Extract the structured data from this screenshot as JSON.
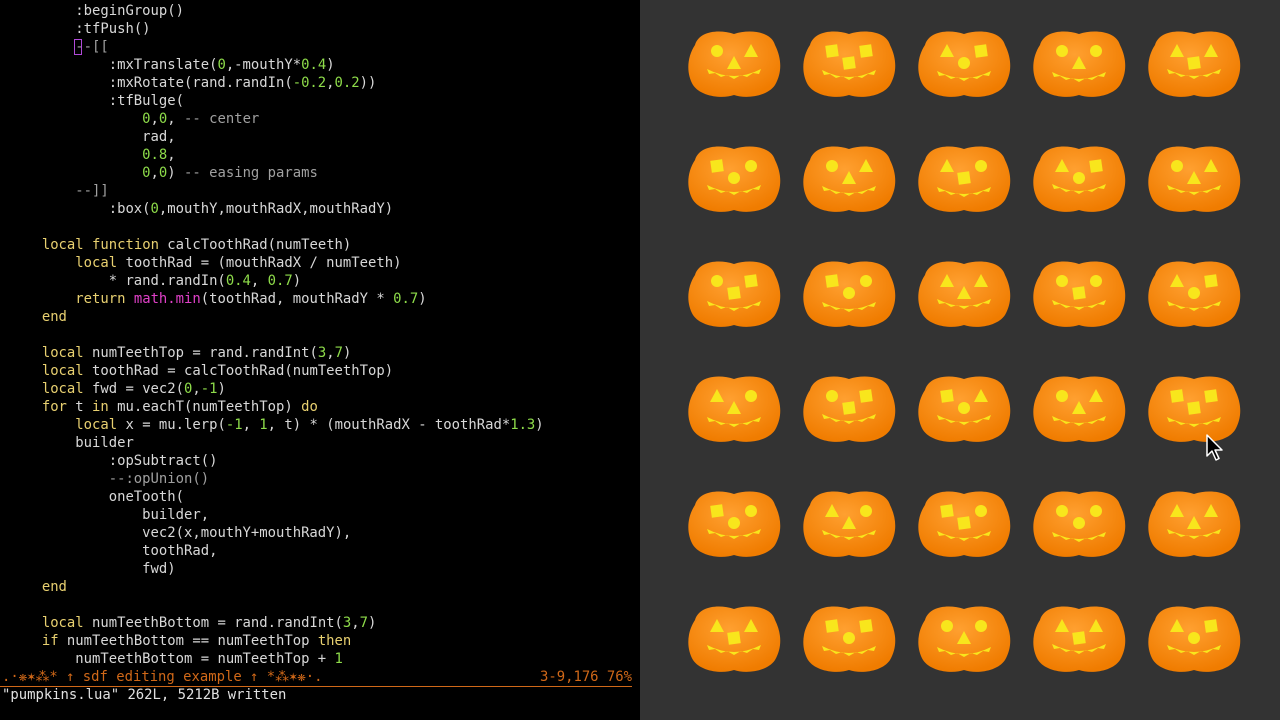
{
  "editor": {
    "lines": [
      {
        "row": 0,
        "indent": 2,
        "tokens": [
          [
            ":beginGroup()",
            "txt"
          ]
        ]
      },
      {
        "row": 1,
        "indent": 2,
        "tokens": [
          [
            ":tfPush()",
            "txt"
          ]
        ]
      },
      {
        "row": 2,
        "indent": 2,
        "tokens": [
          [
            "--[[",
            "com"
          ]
        ]
      },
      {
        "row": 3,
        "indent": 3,
        "tokens": [
          [
            ":mxTranslate(",
            "txt"
          ],
          [
            "0",
            "num"
          ],
          [
            ",-mouthY*",
            "txt"
          ],
          [
            "0.4",
            "num"
          ],
          [
            ")",
            "txt"
          ]
        ]
      },
      {
        "row": 4,
        "indent": 3,
        "tokens": [
          [
            ":mxRotate(rand.randIn(",
            "txt"
          ],
          [
            "-0.2",
            "num"
          ],
          [
            ",",
            "txt"
          ],
          [
            "0.2",
            "num"
          ],
          [
            "))",
            "txt"
          ]
        ]
      },
      {
        "row": 5,
        "indent": 3,
        "tokens": [
          [
            ":tfBulge(",
            "txt"
          ]
        ]
      },
      {
        "row": 6,
        "indent": 4,
        "tokens": [
          [
            "0",
            "num"
          ],
          [
            ",",
            "txt"
          ],
          [
            "0",
            "num"
          ],
          [
            ", ",
            "txt"
          ],
          [
            "-- center",
            "com"
          ]
        ]
      },
      {
        "row": 7,
        "indent": 4,
        "tokens": [
          [
            "rad,",
            "txt"
          ]
        ]
      },
      {
        "row": 8,
        "indent": 4,
        "tokens": [
          [
            "0.8",
            "num"
          ],
          [
            ",",
            "txt"
          ]
        ]
      },
      {
        "row": 9,
        "indent": 4,
        "tokens": [
          [
            "0",
            "num"
          ],
          [
            ",",
            "txt"
          ],
          [
            "0",
            "num"
          ],
          [
            ") ",
            "txt"
          ],
          [
            "-- easing params",
            "com"
          ]
        ]
      },
      {
        "row": 10,
        "indent": 2,
        "tokens": [
          [
            "--]]",
            "com"
          ]
        ]
      },
      {
        "row": 11,
        "indent": 3,
        "tokens": [
          [
            ":box(",
            "txt"
          ],
          [
            "0",
            "num"
          ],
          [
            ",mouthY,mouthRadX,mouthRadY)",
            "txt"
          ]
        ]
      },
      {
        "row": 13,
        "indent": 1,
        "tokens": [
          [
            "local",
            "kw"
          ],
          [
            " ",
            "txt"
          ],
          [
            "function",
            "kw"
          ],
          [
            " calcToothRad(numTeeth)",
            "txt"
          ]
        ]
      },
      {
        "row": 14,
        "indent": 2,
        "tokens": [
          [
            "local",
            "kw"
          ],
          [
            " toothRad = (mouthRadX / numTeeth)",
            "txt"
          ]
        ]
      },
      {
        "row": 15,
        "indent": 3,
        "tokens": [
          [
            "* rand.randIn(",
            "txt"
          ],
          [
            "0.4",
            "num"
          ],
          [
            ", ",
            "txt"
          ],
          [
            "0.7",
            "num"
          ],
          [
            ")",
            "txt"
          ]
        ]
      },
      {
        "row": 16,
        "indent": 2,
        "tokens": [
          [
            "return",
            "kw"
          ],
          [
            " ",
            "txt"
          ],
          [
            "math.min",
            "fn"
          ],
          [
            "(toothRad, mouthRadY * ",
            "txt"
          ],
          [
            "0.7",
            "num"
          ],
          [
            ")",
            "txt"
          ]
        ]
      },
      {
        "row": 17,
        "indent": 1,
        "tokens": [
          [
            "end",
            "kw"
          ]
        ]
      },
      {
        "row": 19,
        "indent": 1,
        "tokens": [
          [
            "local",
            "kw"
          ],
          [
            " numTeethTop = rand.randInt(",
            "txt"
          ],
          [
            "3",
            "num"
          ],
          [
            ",",
            "txt"
          ],
          [
            "7",
            "num"
          ],
          [
            ")",
            "txt"
          ]
        ]
      },
      {
        "row": 20,
        "indent": 1,
        "tokens": [
          [
            "local",
            "kw"
          ],
          [
            " toothRad = calcToothRad(numTeethTop)",
            "txt"
          ]
        ]
      },
      {
        "row": 21,
        "indent": 1,
        "tokens": [
          [
            "local",
            "kw"
          ],
          [
            " fwd = vec2(",
            "txt"
          ],
          [
            "0",
            "num"
          ],
          [
            ",",
            "txt"
          ],
          [
            "-1",
            "num"
          ],
          [
            ")",
            "txt"
          ]
        ]
      },
      {
        "row": 22,
        "indent": 1,
        "tokens": [
          [
            "for",
            "kw"
          ],
          [
            " t ",
            "txt"
          ],
          [
            "in",
            "kw"
          ],
          [
            " mu.eachT(numTeethTop) ",
            "txt"
          ],
          [
            "do",
            "kw"
          ]
        ]
      },
      {
        "row": 23,
        "indent": 2,
        "tokens": [
          [
            "local",
            "kw"
          ],
          [
            " x = mu.lerp(",
            "txt"
          ],
          [
            "-1",
            "num"
          ],
          [
            ", ",
            "txt"
          ],
          [
            "1",
            "num"
          ],
          [
            ", t) * (mouthRadX - toothRad*",
            "txt"
          ],
          [
            "1.3",
            "num"
          ],
          [
            ")",
            "txt"
          ]
        ]
      },
      {
        "row": 24,
        "indent": 2,
        "tokens": [
          [
            "builder",
            "txt"
          ]
        ]
      },
      {
        "row": 25,
        "indent": 3,
        "tokens": [
          [
            ":opSubtract()",
            "txt"
          ]
        ]
      },
      {
        "row": 26,
        "indent": 3,
        "tokens": [
          [
            "--:opUnion()",
            "com"
          ]
        ]
      },
      {
        "row": 27,
        "indent": 3,
        "tokens": [
          [
            "oneTooth(",
            "txt"
          ]
        ]
      },
      {
        "row": 28,
        "indent": 4,
        "tokens": [
          [
            "builder,",
            "txt"
          ]
        ]
      },
      {
        "row": 29,
        "indent": 4,
        "tokens": [
          [
            "vec2(x,mouthY+mouthRadY),",
            "txt"
          ]
        ]
      },
      {
        "row": 30,
        "indent": 4,
        "tokens": [
          [
            "toothRad,",
            "txt"
          ]
        ]
      },
      {
        "row": 31,
        "indent": 4,
        "tokens": [
          [
            "fwd)",
            "txt"
          ]
        ]
      },
      {
        "row": 32,
        "indent": 1,
        "tokens": [
          [
            "end",
            "kw"
          ]
        ]
      },
      {
        "row": 34,
        "indent": 1,
        "tokens": [
          [
            "local",
            "kw"
          ],
          [
            " numTeethBottom = rand.randInt(",
            "txt"
          ],
          [
            "3",
            "num"
          ],
          [
            ",",
            "txt"
          ],
          [
            "7",
            "num"
          ],
          [
            ")",
            "txt"
          ]
        ]
      },
      {
        "row": 35,
        "indent": 1,
        "tokens": [
          [
            "if",
            "kw"
          ],
          [
            " numTeethBottom == numTeethTop ",
            "txt"
          ],
          [
            "then",
            "kw"
          ]
        ]
      },
      {
        "row": 36,
        "indent": 2,
        "tokens": [
          [
            "numTeethBottom = numTeethTop + ",
            "txt"
          ],
          [
            "1",
            "num"
          ]
        ]
      }
    ],
    "statusline": {
      "left": ".·❋✶⁂* ↑ sdf editing example ↑ *⁂✶❋·.",
      "right": "3-9,176 76%"
    },
    "message": "\"pumpkins.lua\" 262L, 5212B written"
  },
  "colors": {
    "keyword": "#e8d070",
    "number": "#8edc4a",
    "comment": "#a0a0a0",
    "builtin": "#e040c8",
    "text": "#d8d8d8",
    "status": "#d06818",
    "viewport_bg": "#333333",
    "pumpkin": "#f07c00",
    "pumpkin_light": "#ffa030",
    "face": "#f8e61c"
  },
  "pumpkins": {
    "rows": 6,
    "cols": 5,
    "faces": [
      [
        "circle",
        "triangle"
      ],
      [
        "square",
        "square"
      ],
      [
        "triangle",
        "square"
      ],
      [
        "circle",
        "circle"
      ],
      [
        "triangle",
        "triangle"
      ],
      [
        "square",
        "circle"
      ],
      [
        "circle",
        "triangle"
      ],
      [
        "triangle",
        "circle"
      ],
      [
        "triangle",
        "square"
      ],
      [
        "circle",
        "triangle"
      ],
      [
        "circle",
        "square"
      ],
      [
        "square",
        "circle"
      ],
      [
        "triangle",
        "triangle"
      ],
      [
        "circle",
        "circle"
      ],
      [
        "triangle",
        "square"
      ],
      [
        "triangle",
        "circle"
      ],
      [
        "circle",
        "square"
      ],
      [
        "square",
        "triangle"
      ],
      [
        "circle",
        "triangle"
      ],
      [
        "square",
        "square"
      ],
      [
        "square",
        "circle"
      ],
      [
        "triangle",
        "circle"
      ],
      [
        "square",
        "circle"
      ],
      [
        "circle",
        "circle"
      ],
      [
        "triangle",
        "triangle"
      ],
      [
        "triangle",
        "triangle"
      ],
      [
        "square",
        "square"
      ],
      [
        "circle",
        "circle"
      ],
      [
        "triangle",
        "triangle"
      ],
      [
        "triangle",
        "square"
      ]
    ]
  }
}
